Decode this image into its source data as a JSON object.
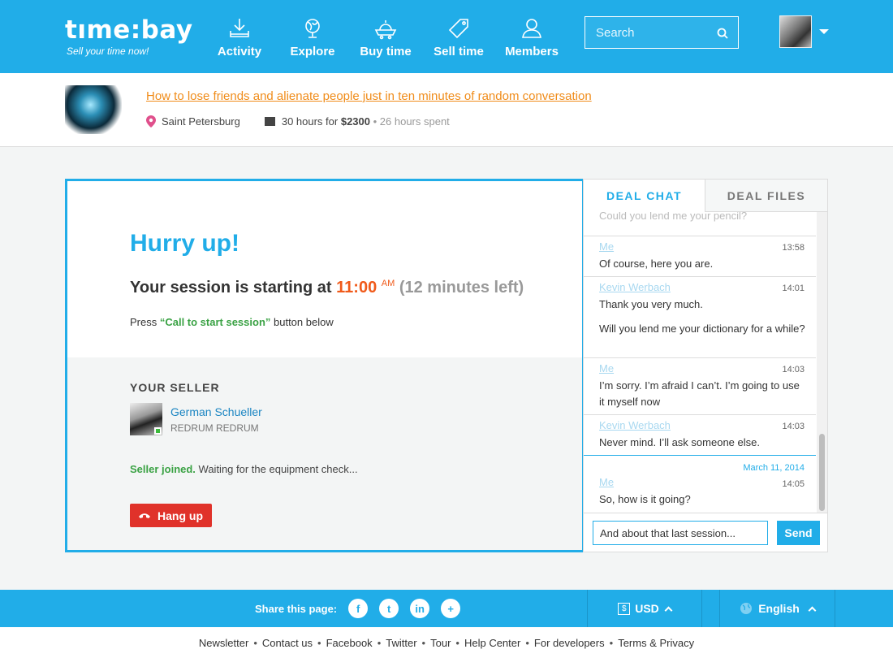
{
  "header": {
    "logo_text": "tıme:bay",
    "logo_tagline": "Sell your time now!",
    "nav": [
      {
        "label": "Activity",
        "icon": "download-tray-icon"
      },
      {
        "label": "Explore",
        "icon": "globe-icon"
      },
      {
        "label": "Buy time",
        "icon": "shopping-cart-icon"
      },
      {
        "label": "Sell time",
        "icon": "price-tag-icon"
      },
      {
        "label": "Members",
        "icon": "user-icon"
      }
    ],
    "search_placeholder": "Search"
  },
  "deal": {
    "title": "How to lose friends and alienate people just in ten minutes of random conversation",
    "location": "Saint Petersburg",
    "package": "30 hours for ",
    "price": "$2300",
    "separator": " • ",
    "spent": "26 hours spent"
  },
  "session": {
    "headline": "Hurry up!",
    "starting_prefix": "Your session is starting at ",
    "start_time": "11:00",
    "ampm": "AM",
    "time_left": "(12 minutes left)",
    "press_prefix": "Press ",
    "press_quote": "“Call to start session”",
    "press_suffix": " button below",
    "seller_heading": "YOUR SELLER",
    "seller_name": "German Schueller",
    "seller_subtitle": "REDRUM REDRUM",
    "status_joined": "Seller joined.",
    "status_rest": " Waiting for the equipment check...",
    "hangup_label": "Hang up"
  },
  "chat": {
    "tabs": [
      "DEAL CHAT",
      "DEAL FILES"
    ],
    "faded_text": "Could you lend me your pencil?",
    "messages": [
      {
        "author": "Me",
        "time": "13:58",
        "lines": [
          "Of course, here you are."
        ]
      },
      {
        "author": "Kevin Werbach",
        "time": "14:01",
        "lines": [
          "Thank you very much.",
          "Will you lend me your dictionary for a while?"
        ]
      },
      {
        "author": "Me",
        "time": "14:03",
        "lines": [
          "I’m sorry. I’m afraid I can’t. I’m going to use it myself now"
        ]
      },
      {
        "author": "Kevin Werbach",
        "time": "14:03",
        "lines": [
          "Never mind. I’ll ask someone else."
        ]
      },
      {
        "date": "March 11, 2014",
        "author": "Me",
        "time": "14:05",
        "lines": [
          "So, how is it going?"
        ]
      }
    ],
    "input_value": "And about that last session...",
    "send_label": "Send"
  },
  "footer": {
    "share_label": "Share this page:",
    "share_icons": [
      "facebook-icon",
      "twitter-icon",
      "linkedin-icon",
      "plus-icon"
    ],
    "share_glyphs": [
      "f",
      "t",
      "in",
      "+"
    ],
    "currency_symbol": "$",
    "currency": "USD",
    "language": "English",
    "links": [
      "Newsletter",
      "Contact us",
      "Facebook",
      "Twitter",
      "Tour",
      "Help Center",
      "For developers",
      "Terms & Privacy"
    ]
  },
  "colors": {
    "brand": "#21ade8",
    "accent_orange": "#f08c1a",
    "time_orange": "#f05a1a",
    "success": "#3aa244",
    "danger": "#e0322a"
  }
}
